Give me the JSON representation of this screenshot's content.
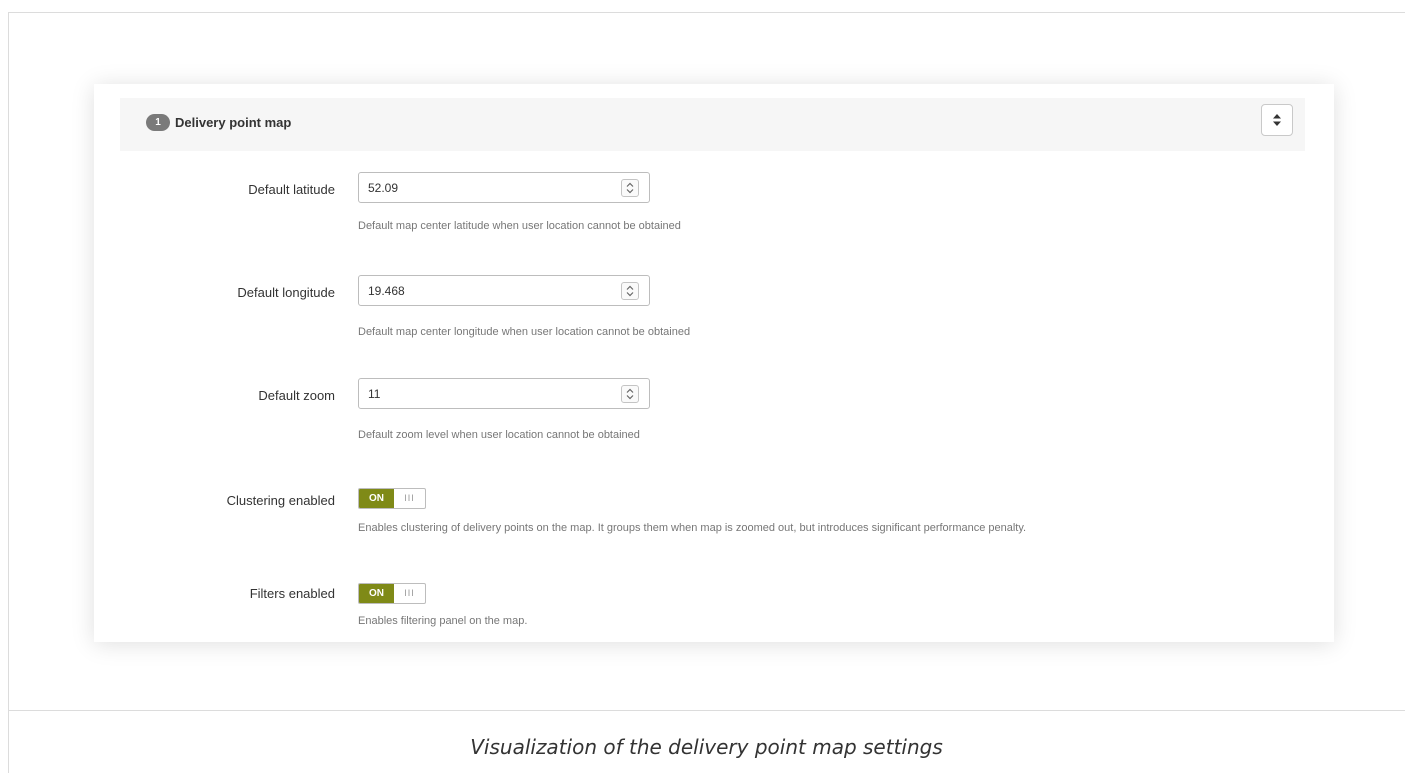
{
  "header": {
    "step_number": "1",
    "title": "Delivery point map",
    "sort_icon": "sort-icon"
  },
  "fields": {
    "latitude": {
      "label": "Default latitude",
      "value": "52.09",
      "help": "Default map center latitude when user location cannot be obtained"
    },
    "longitude": {
      "label": "Default longitude",
      "value": "19.468",
      "help": "Default map center longitude when user location cannot be obtained"
    },
    "zoom": {
      "label": "Default zoom",
      "value": "11",
      "help": "Default zoom level when user location cannot be obtained"
    },
    "clustering": {
      "label": "Clustering enabled",
      "state": "ON",
      "grip": "III",
      "help": "Enables clustering of delivery points on the map. It groups them when map is zoomed out, but introduces significant performance penalty."
    },
    "filters": {
      "label": "Filters enabled",
      "state": "ON",
      "grip": "III",
      "help": "Enables filtering panel on the map."
    }
  },
  "caption": "Visualization of the delivery point map settings",
  "colors": {
    "toggle_on": "#7f8a17",
    "badge": "#7a7a7a",
    "header_bg": "#f6f6f6"
  }
}
